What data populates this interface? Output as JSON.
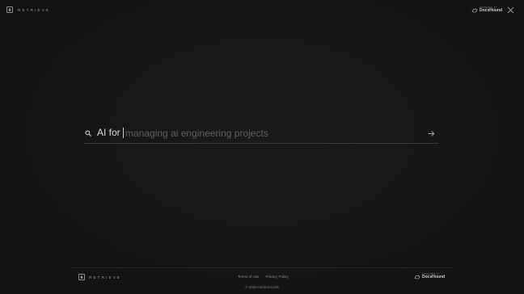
{
  "header": {
    "logo_mark": "R",
    "logo_text": "RETRIEVE",
    "powered_by_label": "POWERED BY",
    "powered_by_name": "DocsHound"
  },
  "search": {
    "prefix": "AI for",
    "placeholder": "managing ai engineering projects",
    "value": ""
  },
  "footer": {
    "logo_mark": "R",
    "logo_text": "RETRIEVE",
    "links": [
      "Terms of Use",
      "Privacy Policy"
    ],
    "powered_by_label": "POWERED BY",
    "powered_by_name": "DocsHound",
    "copyright": "© 2025 retrieve.tools"
  },
  "icons": {
    "search": "search-icon",
    "submit": "arrow-right-icon",
    "close": "close-icon",
    "docshound": "docshound-logo-icon"
  },
  "colors": {
    "background": "#151515",
    "text": "#d9d9d9",
    "placeholder": "#5c5c5c"
  }
}
